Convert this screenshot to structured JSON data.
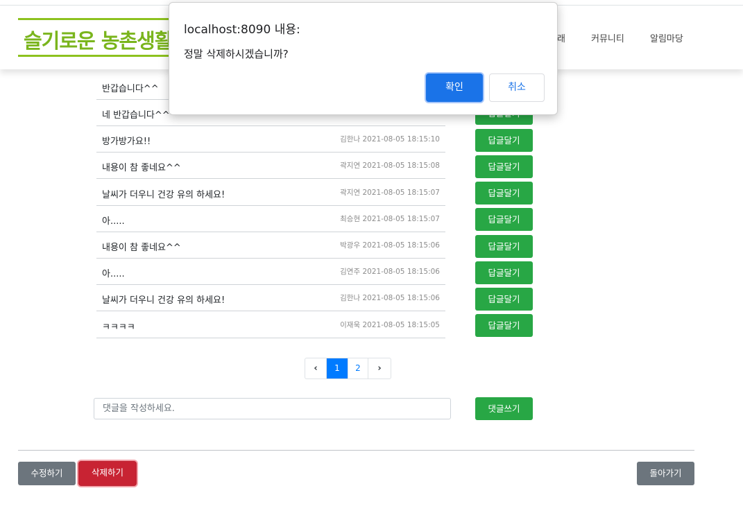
{
  "header": {
    "logo_text": "슬기로운 농촌생활",
    "nav": [
      "래",
      "커뮤니티",
      "알림마당"
    ]
  },
  "comments": [
    {
      "content": "반갑습니다^^",
      "author": "",
      "date": "",
      "reply": ""
    },
    {
      "content": "네 반갑습니다^^^^",
      "author": "",
      "date": "",
      "reply": "답글달기"
    },
    {
      "content": "방가방가요!!",
      "author": "김한나",
      "date": "2021-08-05 18:15:10",
      "reply": "답글달기"
    },
    {
      "content": "내용이 참 좋네요^^",
      "author": "곽지연",
      "date": "2021-08-05 18:15:08",
      "reply": "답글달기"
    },
    {
      "content": "날씨가 더우니 건강 유의 하세요!",
      "author": "곽지연",
      "date": "2021-08-05 18:15:07",
      "reply": "답글달기"
    },
    {
      "content": "아.....",
      "author": "최승현",
      "date": "2021-08-05 18:15:07",
      "reply": "답글달기"
    },
    {
      "content": "내용이 참 좋네요^^",
      "author": "박광우",
      "date": "2021-08-05 18:15:06",
      "reply": "답글달기"
    },
    {
      "content": "아.....",
      "author": "김연주",
      "date": "2021-08-05 18:15:06",
      "reply": "답글달기"
    },
    {
      "content": "날씨가 더우니 건강 유의 하세요!",
      "author": "김한나",
      "date": "2021-08-05 18:15:06",
      "reply": "답글달기"
    },
    {
      "content": "ㅋㅋㅋㅋ",
      "author": "이재욱",
      "date": "2021-08-05 18:15:05",
      "reply": "답글달기"
    }
  ],
  "pagination": {
    "prev": "‹",
    "pages": [
      "1",
      "2"
    ],
    "current": "1",
    "next": "›"
  },
  "comment_form": {
    "placeholder": "댓글을 작성하세요.",
    "submit_label": "댓글쓰기"
  },
  "actions": {
    "edit_label": "수정하기",
    "delete_label": "삭제하기",
    "back_label": "돌아가기"
  },
  "dialog": {
    "title": "localhost:8090 내용:",
    "message": "정말 삭제하시겠습니까?",
    "ok_label": "확인",
    "cancel_label": "취소"
  },
  "colors": {
    "accent": "#1a73e8",
    "success": "#28a745",
    "danger": "#c82333",
    "secondary": "#6c757d",
    "logo": "#7ab51d"
  }
}
